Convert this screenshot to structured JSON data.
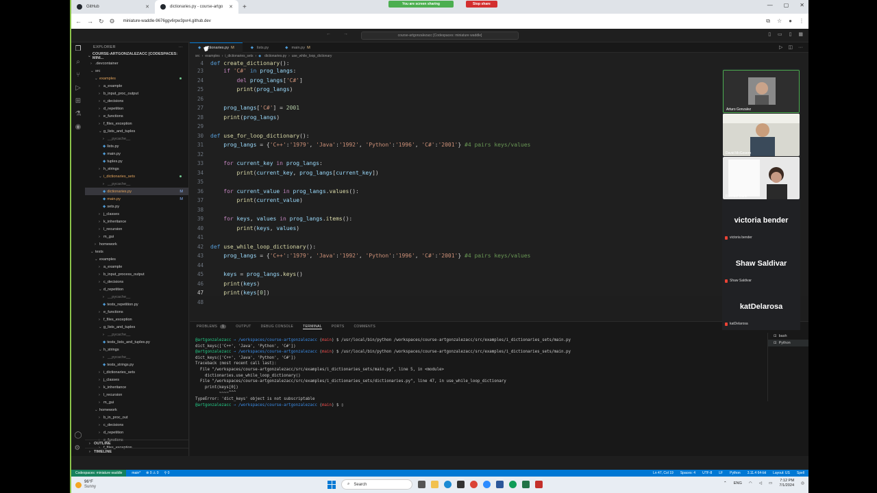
{
  "browser": {
    "tabs": [
      {
        "label": "GitHub"
      },
      {
        "label": "dictionaries.py - course-artgo"
      }
    ],
    "sharing_text": "You are screen sharing",
    "stop_sharing": "Stop share",
    "url": "miniature-waddle-9676ggv6rpw3pvr4.github.dev"
  },
  "vscode": {
    "command_center": "course-artgonzalezacc [Codespaces: miniature waddle]",
    "explorer_title": "EXPLORER",
    "project": "COURSE-ARTGONZALEZACC [CODESPACES: MINI...",
    "tree": [
      {
        "label": ".devcontainer",
        "indent": 0,
        "type": "folder-closed"
      },
      {
        "label": "src",
        "indent": 0,
        "type": "folder-open"
      },
      {
        "label": "examples",
        "indent": 1,
        "type": "folder-open",
        "color": "orange",
        "dot": true
      },
      {
        "label": "a_example",
        "indent": 2,
        "type": "folder-closed"
      },
      {
        "label": "b_input_proc_output",
        "indent": 2,
        "type": "folder-closed"
      },
      {
        "label": "c_decisions",
        "indent": 2,
        "type": "folder-closed"
      },
      {
        "label": "d_repetition",
        "indent": 2,
        "type": "folder-closed"
      },
      {
        "label": "e_functions",
        "indent": 2,
        "type": "folder-closed"
      },
      {
        "label": "f_files_exception",
        "indent": 2,
        "type": "folder-closed"
      },
      {
        "label": "g_lists_and_tuples",
        "indent": 2,
        "type": "folder-open"
      },
      {
        "label": "__pycache__",
        "indent": 3,
        "type": "folder-closed",
        "color": "dim"
      },
      {
        "label": "lists.py",
        "indent": 3,
        "type": "file"
      },
      {
        "label": "main.py",
        "indent": 3,
        "type": "file"
      },
      {
        "label": "tuples.py",
        "indent": 3,
        "type": "file"
      },
      {
        "label": "h_strings",
        "indent": 2,
        "type": "folder-closed"
      },
      {
        "label": "i_dictionaries_sets",
        "indent": 2,
        "type": "folder-open",
        "color": "orange",
        "dot": true
      },
      {
        "label": "__pycache__",
        "indent": 3,
        "type": "folder-closed",
        "color": "dim"
      },
      {
        "label": "dictionaries.py",
        "indent": 3,
        "type": "file",
        "selected": true,
        "mark": "M",
        "color": "orange"
      },
      {
        "label": "main.py",
        "indent": 3,
        "type": "file",
        "mark": "M",
        "color": "orange"
      },
      {
        "label": "sets.py",
        "indent": 3,
        "type": "file"
      },
      {
        "label": "j_classes",
        "indent": 2,
        "type": "folder-closed"
      },
      {
        "label": "k_inheritance",
        "indent": 2,
        "type": "folder-closed"
      },
      {
        "label": "l_recursion",
        "indent": 2,
        "type": "folder-closed"
      },
      {
        "label": "m_gui",
        "indent": 2,
        "type": "folder-closed"
      },
      {
        "label": "homework",
        "indent": 1,
        "type": "folder-closed"
      },
      {
        "label": "tests",
        "indent": 0,
        "type": "folder-open"
      },
      {
        "label": "examples",
        "indent": 1,
        "type": "folder-open"
      },
      {
        "label": "a_example",
        "indent": 2,
        "type": "folder-closed"
      },
      {
        "label": "b_input_process_output",
        "indent": 2,
        "type": "folder-closed"
      },
      {
        "label": "c_decisions",
        "indent": 2,
        "type": "folder-closed"
      },
      {
        "label": "d_repetition",
        "indent": 2,
        "type": "folder-open"
      },
      {
        "label": "__pycache__",
        "indent": 3,
        "type": "folder-closed",
        "color": "dim"
      },
      {
        "label": "tests_repetition.py",
        "indent": 3,
        "type": "file"
      },
      {
        "label": "e_functions",
        "indent": 2,
        "type": "folder-closed"
      },
      {
        "label": "f_files_exception",
        "indent": 2,
        "type": "folder-closed"
      },
      {
        "label": "g_lists_and_tuples",
        "indent": 2,
        "type": "folder-open"
      },
      {
        "label": "__pycache__",
        "indent": 3,
        "type": "folder-closed",
        "color": "dim"
      },
      {
        "label": "tests_lists_and_tuples.py",
        "indent": 3,
        "type": "file"
      },
      {
        "label": "h_strings",
        "indent": 2,
        "type": "folder-open"
      },
      {
        "label": "__pycache__",
        "indent": 3,
        "type": "folder-closed",
        "color": "dim"
      },
      {
        "label": "tests_strings.py",
        "indent": 3,
        "type": "file"
      },
      {
        "label": "i_dictionaries_sets",
        "indent": 2,
        "type": "folder-closed"
      },
      {
        "label": "j_classes",
        "indent": 2,
        "type": "folder-closed"
      },
      {
        "label": "k_inheritance",
        "indent": 2,
        "type": "folder-closed"
      },
      {
        "label": "l_recursion",
        "indent": 2,
        "type": "folder-closed"
      },
      {
        "label": "m_gui",
        "indent": 2,
        "type": "folder-closed"
      },
      {
        "label": "homework",
        "indent": 1,
        "type": "folder-open"
      },
      {
        "label": "b_in_proc_out",
        "indent": 2,
        "type": "folder-closed"
      },
      {
        "label": "c_decisions",
        "indent": 2,
        "type": "folder-closed"
      },
      {
        "label": "d_repetition",
        "indent": 2,
        "type": "folder-closed"
      },
      {
        "label": "e_functions",
        "indent": 2,
        "type": "folder-closed"
      },
      {
        "label": "f_files_exception",
        "indent": 2,
        "type": "folder-closed"
      }
    ],
    "outline": "OUTLINE",
    "timeline": "TIMELINE",
    "editor_tabs": [
      {
        "label": "dictionaries.py",
        "mark": "M",
        "active": true
      },
      {
        "label": "lists.py",
        "mark": ""
      },
      {
        "label": "main.py",
        "mark": "M"
      }
    ],
    "breadcrumb": [
      "src",
      "examples",
      "i_dictionaries_sets",
      "dictionaries.py",
      "use_while_loop_dictionary"
    ],
    "sticky": {
      "ln": "4",
      "text": "def create_dictionary():"
    },
    "code_lines": [
      {
        "ln": "23",
        "html": "    <span class='kw'>if</span> <span class='s'>'C#'</span> <span class='k'>in</span> <span class='v'>prog_langs</span>:"
      },
      {
        "ln": "24",
        "html": "        <span class='kw'>del</span> <span class='v'>prog_langs</span>[<span class='s'>'C#'</span>]"
      },
      {
        "ln": "25",
        "html": "        <span class='fn'>print</span>(<span class='v'>prog_langs</span>)"
      },
      {
        "ln": "26",
        "html": ""
      },
      {
        "ln": "27",
        "html": "    <span class='v'>prog_langs</span>[<span class='s'>'C#'</span>] = <span class='n'>2001</span>"
      },
      {
        "ln": "28",
        "html": "    <span class='fn'>print</span>(<span class='v'>prog_langs</span>)"
      },
      {
        "ln": "29",
        "html": ""
      },
      {
        "ln": "30",
        "html": "<span class='k'>def</span> <span class='fn'>use_for_loop_dictionary</span>():"
      },
      {
        "ln": "31",
        "html": "    <span class='v'>prog_langs</span> = {<span class='s'>'C++'</span>:<span class='s'>'1979'</span>, <span class='s'>'Java'</span>:<span class='s'>'1992'</span>, <span class='s'>'Python'</span>:<span class='s'>'1996'</span>, <span class='s'>'C#'</span>:<span class='s'>'2001'</span>} <span class='c'>#4 pairs keys/values</span>"
      },
      {
        "ln": "32",
        "html": ""
      },
      {
        "ln": "33",
        "html": "    <span class='kw'>for</span> <span class='v'>current_key</span> <span class='kw'>in</span> <span class='v'>prog_langs</span>:"
      },
      {
        "ln": "34",
        "html": "        <span class='fn'>print</span>(<span class='v'>current_key</span>, <span class='v'>prog_langs</span>[<span class='v'>current_key</span>])"
      },
      {
        "ln": "35",
        "html": ""
      },
      {
        "ln": "36",
        "html": "    <span class='kw'>for</span> <span class='v'>current_value</span> <span class='kw'>in</span> <span class='v'>prog_langs</span>.<span class='fn'>values</span>():"
      },
      {
        "ln": "37",
        "html": "        <span class='fn'>print</span>(<span class='v'>current_value</span>)"
      },
      {
        "ln": "38",
        "html": ""
      },
      {
        "ln": "39",
        "html": "    <span class='kw'>for</span> <span class='v'>keys</span>, <span class='v'>values</span> <span class='kw'>in</span> <span class='v'>prog_langs</span>.<span class='fn'>items</span>():"
      },
      {
        "ln": "40",
        "html": "        <span class='fn'>print</span>(<span class='v'>keys</span>, <span class='v'>values</span>)"
      },
      {
        "ln": "41",
        "html": ""
      },
      {
        "ln": "42",
        "html": "<span class='k'>def</span> <span class='fn'>use_while_loop_dictionary</span>():"
      },
      {
        "ln": "43",
        "html": "    <span class='v'>prog_langs</span> = {<span class='s'>'C++'</span>:<span class='s'>'1979'</span>, <span class='s'>'Java'</span>:<span class='s'>'1992'</span>, <span class='s'>'Python'</span>:<span class='s'>'1996'</span>, <span class='s'>'C#'</span>:<span class='s'>'2001'</span>} <span class='c'>#4 pairs keys/values</span>"
      },
      {
        "ln": "44",
        "html": ""
      },
      {
        "ln": "45",
        "html": "    <span class='v'>keys</span> = <span class='v'>prog_langs</span>.<span class='fn'>keys</span>()"
      },
      {
        "ln": "46",
        "html": "    <span class='fn'>print</span>(<span class='v'>keys</span>)"
      },
      {
        "ln": "47",
        "html": "    <span class='fn'>print</span>(<span class='v'>keys</span>[<span class='n'>0</span>])",
        "current": true
      },
      {
        "ln": "48",
        "html": ""
      }
    ],
    "panel_tabs": [
      "PROBLEMS",
      "OUTPUT",
      "DEBUG CONSOLE",
      "TERMINAL",
      "PORTS",
      "COMMENTS"
    ],
    "problems_count": "1",
    "terminal_lines": [
      "<span class='pg'>@artgonzalezacc</span> <span class='pb'>→ /workspaces/course-artgonzalezacc</span> (<span class='pr'>main</span>) $ /usr/local/bin/python /workspaces/course-artgonzalezacc/src/examples/i_dictionaries_sets/main.py",
      "dict_keys(['C++', 'Java', 'Python', 'C#'])",
      "<span class='pg'>@artgonzalezacc</span> <span class='pb'>→ /workspaces/course-artgonzalezacc</span> (<span class='pr'>main</span>) $ /usr/local/bin/python /workspaces/course-artgonzalezacc/src/examples/i_dictionaries_sets/main.py",
      "dict_keys(['C++', 'Java', 'Python', 'C#'])",
      "Traceback (most recent call last):",
      "  File \"/workspaces/course-artgonzalezacc/src/examples/i_dictionaries_sets/main.py\", line 5, in &lt;module&gt;",
      "    dictionaries.use_while_loop_dictionary()",
      "  File \"/workspaces/course-artgonzalezacc/src/examples/i_dictionaries_sets/dictionaries.py\", line 47, in use_while_loop_dictionary",
      "    print(keys[0])",
      "          ~~~~^^^",
      "TypeError: 'dict_keys' object is not subscriptable",
      "<span class='pg'>@artgonzalezacc</span> <span class='pb'>→ /workspaces/course-artgonzalezacc</span> (<span class='pr'>main</span>) $ ▯"
    ],
    "terminals": [
      "bash",
      "Python"
    ],
    "status_left": [
      "Codespaces: miniature waddle",
      "main*",
      "⊗ 0 ⚠ 0",
      "⚲ 0"
    ],
    "status_right": [
      "Ln 47, Col 19",
      "Spaces: 4",
      "UTF-8",
      "LF",
      "Python",
      "3.11.4 64-bit",
      "Layout: US",
      "Spell"
    ]
  },
  "meeting": {
    "video_participants": [
      "Arturo Gonzalez",
      "David McGovern",
      "Rachael Dank"
    ],
    "audio_participants": [
      "victoria bender",
      "Shaw Saldivar",
      "katDelarosa"
    ]
  },
  "taskbar": {
    "temp": "96°F",
    "weather": "Sunny",
    "search": "Search",
    "lang": "ENG",
    "time": "7:12 PM",
    "date": "7/1/2024"
  }
}
